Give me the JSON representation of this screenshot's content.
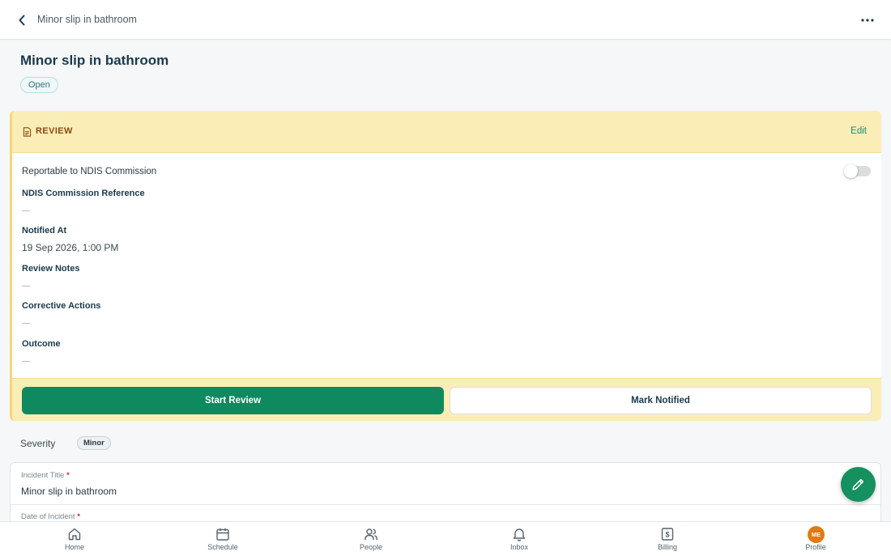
{
  "topbar": {
    "title": "Minor slip in bathroom"
  },
  "page": {
    "title": "Minor slip in bathroom",
    "status": "Open"
  },
  "review": {
    "header": "REVIEW",
    "edit_label": "Edit",
    "reportable_label": "Reportable to NDIS Commission",
    "reportable_on": false,
    "fields": [
      {
        "label": "NDIS Commission Reference",
        "value": "—"
      },
      {
        "label": "Notified At",
        "value": "19 Sep 2026, 1:00 PM"
      },
      {
        "label": "Review Notes",
        "value": "—"
      },
      {
        "label": "Corrective Actions",
        "value": "—"
      },
      {
        "label": "Outcome",
        "value": "—"
      }
    ],
    "start_label": "Start Review",
    "notified_label": "Mark Notified"
  },
  "severity": {
    "label": "Severity",
    "value": "Minor"
  },
  "form": {
    "title_label": "Incident Title",
    "title_value": "Minor slip in bathroom",
    "date_label": "Date of Incident",
    "required_mark": "*"
  },
  "nav": [
    {
      "label": "Home",
      "icon": "home-icon"
    },
    {
      "label": "Schedule",
      "icon": "calendar-icon"
    },
    {
      "label": "People",
      "icon": "people-icon"
    },
    {
      "label": "Inbox",
      "icon": "bell-icon"
    },
    {
      "label": "Billing",
      "icon": "billing-icon"
    },
    {
      "label": "Profile",
      "icon": "avatar",
      "initials": "ME"
    }
  ],
  "colors": {
    "primary": "#0f8a5f",
    "review_bg": "#fbedb6",
    "accent_link": "#1a8a7a",
    "avatar": "#e07a12"
  }
}
